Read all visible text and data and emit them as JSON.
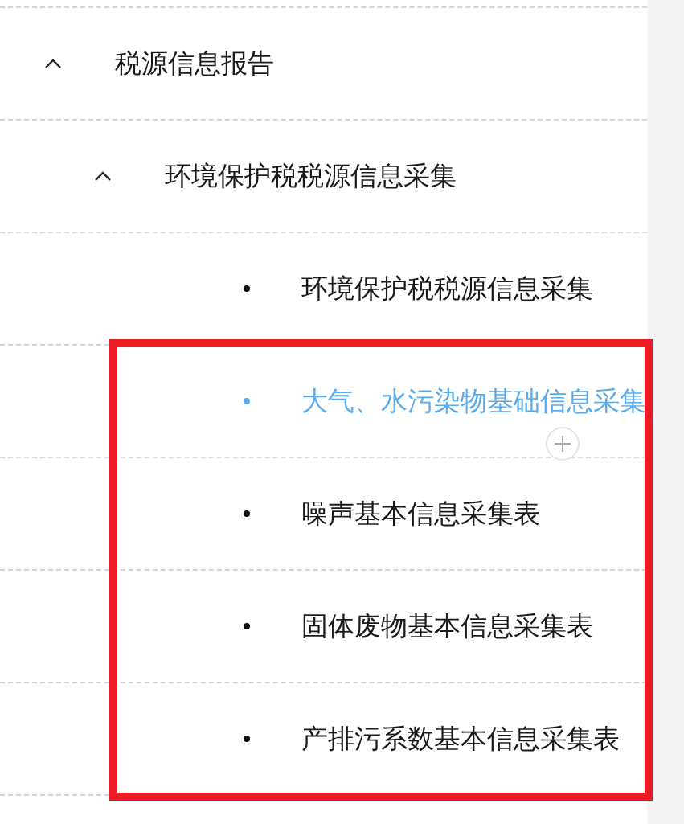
{
  "tree": [
    {
      "label": "税源信息报告",
      "expanded": true,
      "selected": false,
      "children": [
        {
          "label": "环境保护税税源信息采集",
          "expanded": true,
          "selected": false,
          "children": [
            {
              "label": "环境保护税税源信息采集",
              "selected": false,
              "highlighted": false
            },
            {
              "label": "大气、水污染物基础信息采集",
              "selected": true,
              "highlighted": true
            },
            {
              "label": "噪声基本信息采集表",
              "selected": false,
              "highlighted": true
            },
            {
              "label": "固体废物基本信息采集表",
              "selected": false,
              "highlighted": true
            },
            {
              "label": "产排污系数基本信息采集表",
              "selected": false,
              "highlighted": true
            }
          ]
        }
      ]
    }
  ]
}
